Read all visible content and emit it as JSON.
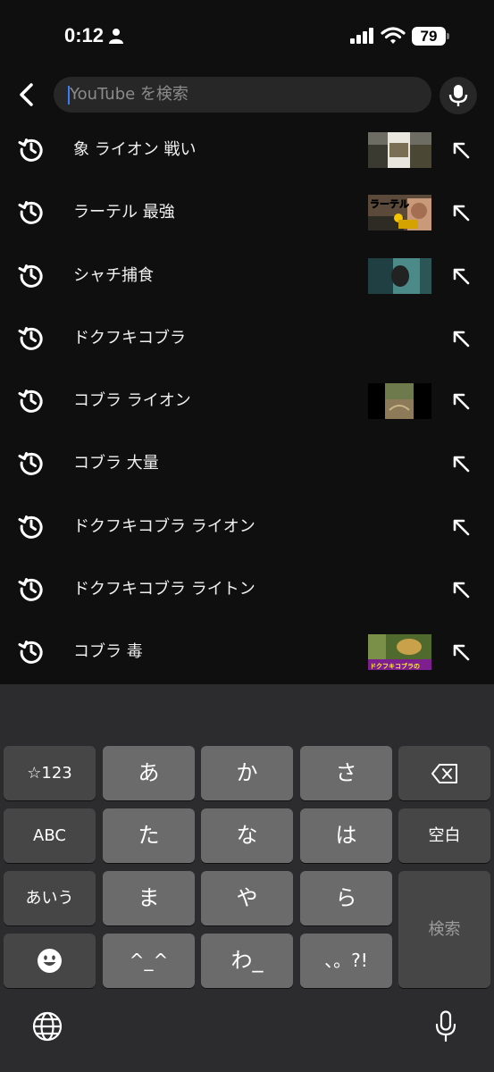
{
  "status_bar": {
    "time": "0:12",
    "battery": "79"
  },
  "search": {
    "placeholder": "YouTube を検索"
  },
  "suggestions": [
    {
      "text": "象 ライオン 戦い",
      "thumb": "elephant-lion-scene"
    },
    {
      "text": "ラーテル 最強",
      "thumb": "ratel-strongest",
      "thumb_caption": "ラーテル"
    },
    {
      "text": "シャチ捕食",
      "thumb": "orca-underwater"
    },
    {
      "text": "ドクフキコブラ"
    },
    {
      "text": "コブラ ライオン",
      "thumb": "cobra-lion-vertical"
    },
    {
      "text": "コブラ 大量"
    },
    {
      "text": "ドクフキコブラ ライオン"
    },
    {
      "text": "ドクフキコブラ ライトン"
    },
    {
      "text": "コブラ 毒",
      "thumb": "spitting-cobra-venom",
      "thumb_caption": "ドクフキコブラの"
    }
  ],
  "keyboard": {
    "rows": [
      [
        "☆123",
        "あ",
        "か",
        "さ",
        "⌫"
      ],
      [
        "ABC",
        "た",
        "な",
        "は",
        "空白"
      ],
      [
        "あいう",
        "ま",
        "や",
        "ら",
        "検索"
      ],
      [
        "☺",
        "^_^",
        "わ_",
        "、。?!"
      ]
    ],
    "delete_icon": "backspace-icon",
    "emoji_icon": "emoji-icon",
    "globe_icon": "globe-icon",
    "dictation_icon": "microphone-icon"
  },
  "colors": {
    "background": "#0f0f0f",
    "search_field": "#272727",
    "caret": "#3d7cf5",
    "key": "#6b6b6b",
    "function_key": "#464646",
    "keyboard_bg": "#2c2c2e"
  }
}
